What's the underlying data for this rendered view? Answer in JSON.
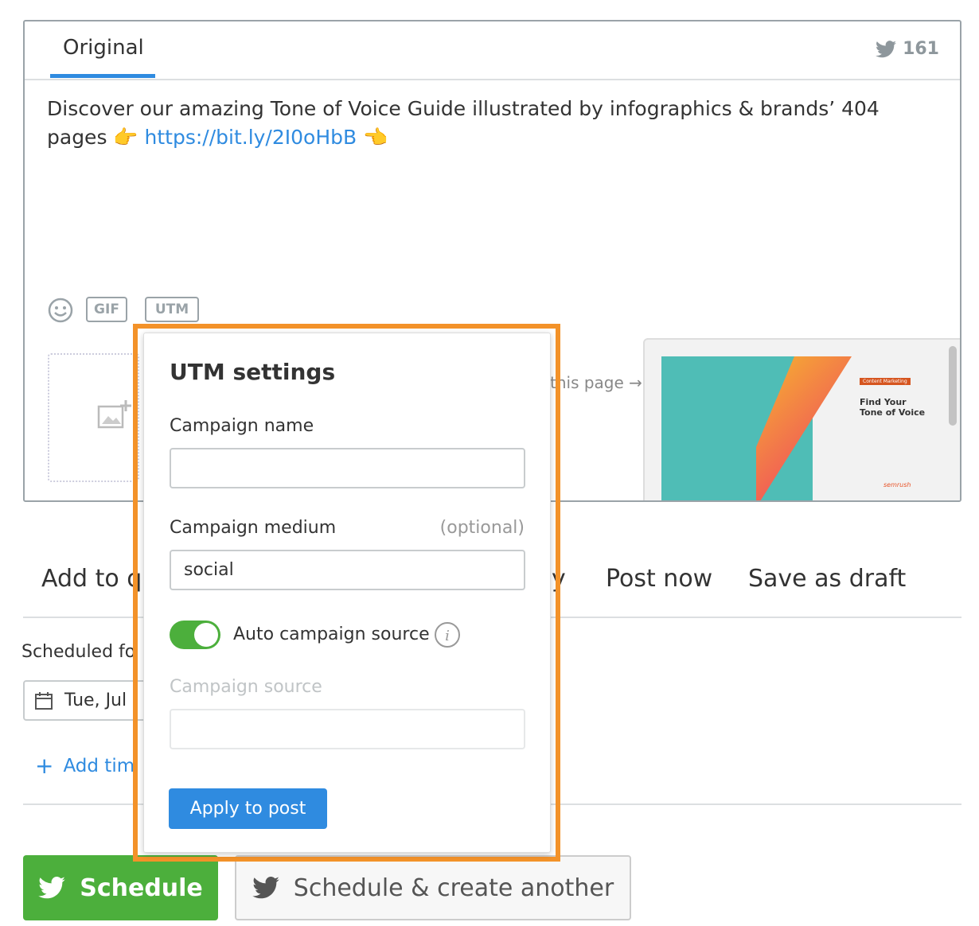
{
  "composer": {
    "tab_label": "Original",
    "char_count": "161",
    "text_before": "Discover our amazing Tone of Voice Guide illustrated by infographics & brands’ 404 pages ",
    "emoji_left": "👉",
    "link": "https://bit.ly/2I0oHbB",
    "emoji_right": "👈",
    "tools": {
      "gif": "GIF",
      "utm": "UTM"
    },
    "link_hint": "this page →",
    "preview": {
      "tag": "Content Marketing",
      "title": "Find Your Tone of Voice",
      "brand": "semrush"
    }
  },
  "actions": {
    "add_to_queue": "Add to q",
    "middle": "y",
    "post_now": "Post now",
    "save_draft": "Save as draft"
  },
  "schedule": {
    "label": "Scheduled fo",
    "date": "Tue, Jul",
    "add_time": "Add tim"
  },
  "buttons": {
    "schedule": "Schedule",
    "schedule_another": "Schedule & create another"
  },
  "utm": {
    "title": "UTM settings",
    "campaign_name_label": "Campaign name",
    "campaign_name_value": "",
    "campaign_medium_label": "Campaign medium",
    "optional": "(optional)",
    "campaign_medium_value": "social",
    "auto_source_label": "Auto campaign source",
    "auto_source_on": true,
    "campaign_source_label": "Campaign source",
    "campaign_source_value": "",
    "apply": "Apply to post"
  },
  "colors": {
    "accent": "#2f8be0",
    "green": "#4caf3c",
    "highlight": "#f39229"
  }
}
